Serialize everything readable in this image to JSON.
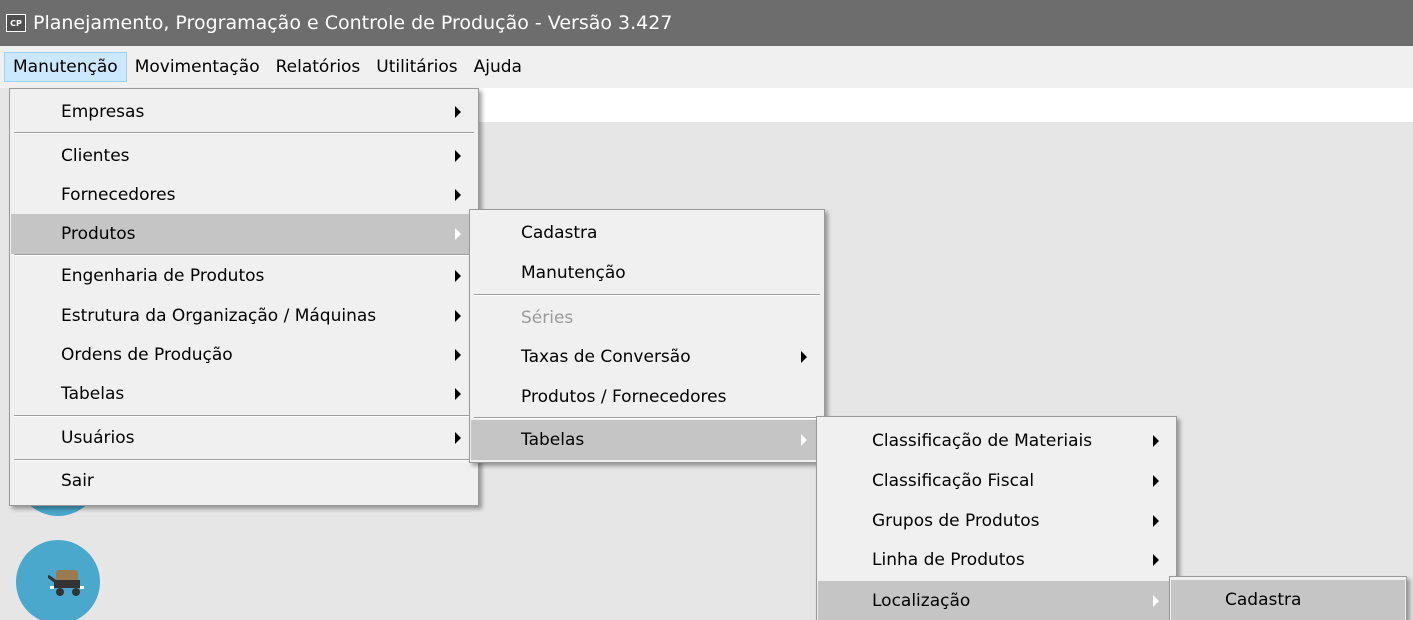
{
  "window": {
    "app_icon_text": "CP",
    "title": "Planejamento, Programação e Controle de Produção - Versão 3.427"
  },
  "menubar": {
    "items": [
      {
        "label": "Manutenção"
      },
      {
        "label": "Movimentação"
      },
      {
        "label": "Relatórios"
      },
      {
        "label": "Utilitários"
      },
      {
        "label": "Ajuda"
      }
    ]
  },
  "menu_manutencao": {
    "items": [
      {
        "label": "Empresas"
      },
      {
        "label": "Clientes"
      },
      {
        "label": "Fornecedores"
      },
      {
        "label": "Produtos"
      },
      {
        "label": "Engenharia de Produtos"
      },
      {
        "label": "Estrutura da Organização / Máquinas"
      },
      {
        "label": "Ordens de Produção"
      },
      {
        "label": "Tabelas"
      },
      {
        "label": "Usuários"
      },
      {
        "label": "Sair"
      }
    ]
  },
  "menu_produtos": {
    "items": [
      {
        "label": "Cadastra"
      },
      {
        "label": "Manutenção"
      },
      {
        "label": "Séries"
      },
      {
        "label": "Taxas de Conversão"
      },
      {
        "label": "Produtos / Fornecedores"
      },
      {
        "label": "Tabelas"
      }
    ]
  },
  "menu_tabelas": {
    "items": [
      {
        "label": "Classificação de Materiais"
      },
      {
        "label": "Classificação Fiscal"
      },
      {
        "label": "Grupos de Produtos"
      },
      {
        "label": "Linha de Produtos"
      },
      {
        "label": "Localização"
      }
    ]
  },
  "menu_localizacao": {
    "items": [
      {
        "label": "Cadastra"
      }
    ]
  },
  "colors": {
    "titlebar": "#6d6d6d",
    "menu_bg": "#f0f0f0",
    "highlight": "#c5c5c5",
    "side_icon": "#4aa8cc"
  }
}
